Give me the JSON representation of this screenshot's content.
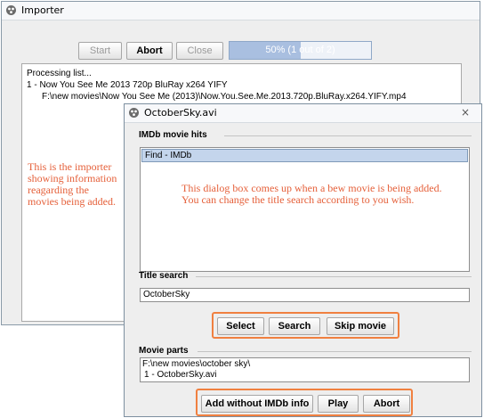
{
  "importer": {
    "title": "Importer",
    "buttons": {
      "start": "Start",
      "abort": "Abort",
      "close": "Close"
    },
    "progress": {
      "label": "50%  (1 out of 2)",
      "fraction": 0.5
    },
    "log": [
      "Processing list...",
      "1 - Now You See Me 2013 720p BluRay x264 YIFY",
      "F:\\new movies\\Now You See Me (2013)\\Now.You.See.Me.2013.720p.BluRay.x264.YIFY.mp4"
    ],
    "annotation": "This is the importer\nshowing information\nreagarding the\nmovies being added."
  },
  "dialog": {
    "title": "OctoberSky.avi",
    "hits_label": "IMDb movie hits",
    "hits": [
      "Find - IMDb"
    ],
    "annotation": "This dialog box comes up when a bew movie is being added.\nYou can change the title search according to you wish.",
    "title_search_label": "Title search",
    "title_search_value": "OctoberSky",
    "buttons": {
      "select": "Select",
      "search": "Search",
      "skip": "Skip movie"
    },
    "movie_parts_label": "Movie parts",
    "movie_parts": [
      "F:\\new movies\\october sky\\",
      "1  - OctoberSky.avi"
    ],
    "bottom_buttons": {
      "add": "Add without IMDb info",
      "play": "Play",
      "abort": "Abort"
    },
    "close_glyph": "×"
  },
  "colors": {
    "annotation": "#e5603a",
    "highlight": "#f08040",
    "progress": "#a9bfe0"
  }
}
